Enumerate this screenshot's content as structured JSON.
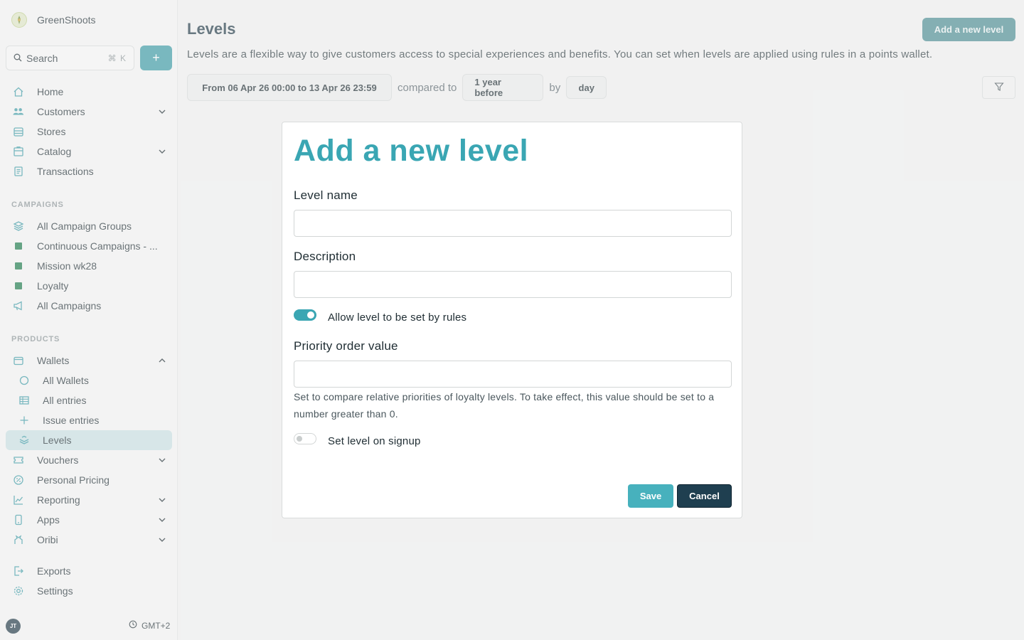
{
  "brand": {
    "name": "GreenShoots"
  },
  "search": {
    "label": "Search",
    "shortcut": "⌘ K",
    "add_label": "+"
  },
  "nav": {
    "home": "Home",
    "customers": "Customers",
    "stores": "Stores",
    "catalog": "Catalog",
    "transactions": "Transactions",
    "campaigns_title": "CAMPAIGNS",
    "all_campaign_groups": "All Campaign Groups",
    "continuous_campaigns": "Continuous Campaigns - ...",
    "mission_wk28": "Mission wk28",
    "loyalty": "Loyalty",
    "all_campaigns": "All Campaigns",
    "products_title": "PRODUCTS",
    "wallets": "Wallets",
    "all_wallets": "All Wallets",
    "all_entries": "All entries",
    "issue_entries": "Issue entries",
    "levels": "Levels",
    "vouchers": "Vouchers",
    "personal_pricing": "Personal Pricing",
    "reporting": "Reporting",
    "apps": "Apps",
    "oribi": "Oribi",
    "exports": "Exports",
    "settings": "Settings"
  },
  "footer": {
    "avatar": "JT",
    "timezone": "GMT+2"
  },
  "page": {
    "title": "Levels",
    "add_button": "Add a new level",
    "description": "Levels are a flexible way to give customers access to special experiences and benefits. You can set when levels are applied using rules in a points wallet.",
    "date_range": "From 06 Apr 26 00:00 to 13 Apr 26 23:59",
    "compared_to_label": "compared to",
    "comparison": "1 year before",
    "by_label": "by",
    "granularity": "day"
  },
  "modal": {
    "title": "Add a new level",
    "level_name_label": "Level name",
    "level_name_value": "",
    "description_label": "Description",
    "description_value": "",
    "allow_rules_label": "Allow level to be set by rules",
    "allow_rules_on": true,
    "priority_label": "Priority order value",
    "priority_value": "",
    "priority_help": "Set to compare relative priorities of loyalty levels. To take effect, this value should be set to a number greater than 0.",
    "signup_label": "Set level on signup",
    "signup_on": false,
    "save": "Save",
    "cancel": "Cancel"
  },
  "colors": {
    "accent": "#3aa6b3",
    "primary_dark": "#1f3f50",
    "active_nav": "#c9e1e4",
    "campaign_square": "#1b7a4a"
  }
}
